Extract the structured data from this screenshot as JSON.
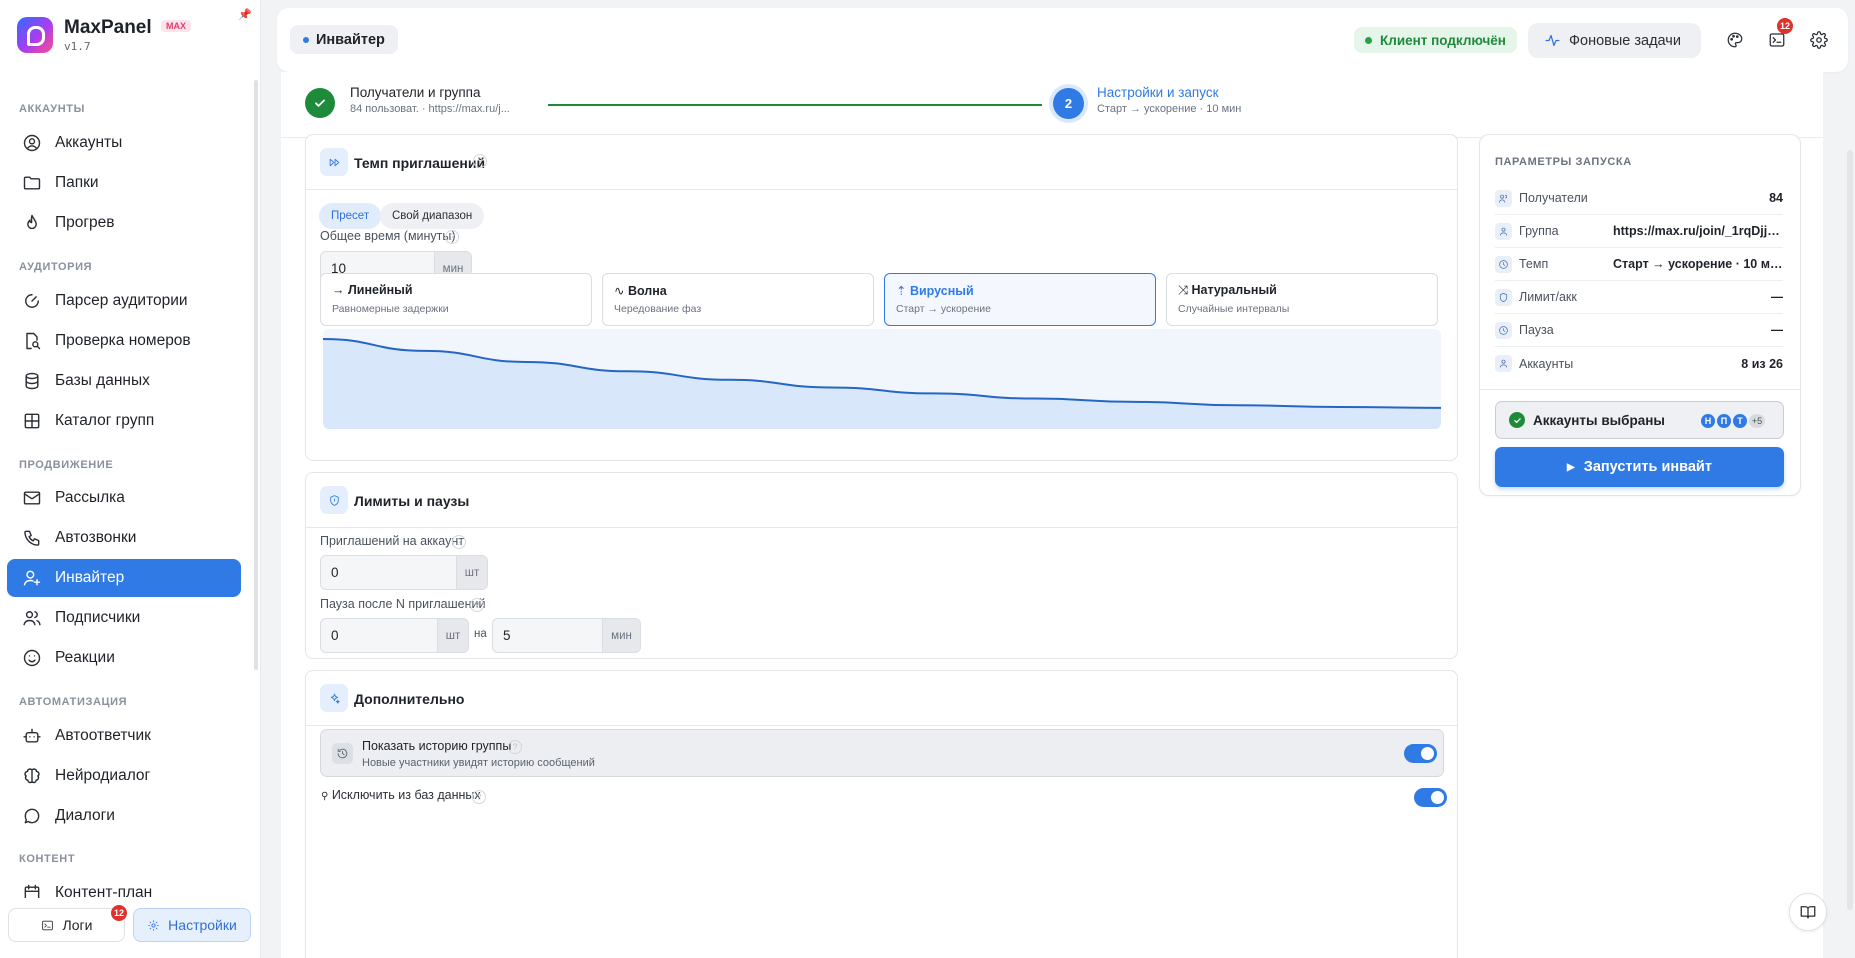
{
  "brand": {
    "name": "MaxPanel",
    "badge": "MAX",
    "version": "v1.7"
  },
  "sidebar": {
    "sections": [
      {
        "title": "АККАУНТЫ"
      },
      {
        "title": "АУДИТОРИЯ"
      },
      {
        "title": "ПРОДВИЖЕНИЕ"
      },
      {
        "title": "АВТОМАТИЗАЦИЯ"
      },
      {
        "title": "КОНТЕНТ"
      }
    ],
    "items": [
      {
        "label": "Аккаунты",
        "icon": "user-circle-icon"
      },
      {
        "label": "Папки",
        "icon": "folder-icon"
      },
      {
        "label": "Прогрев",
        "icon": "flame-icon"
      },
      {
        "label": "Парсер аудитории",
        "icon": "radar-icon"
      },
      {
        "label": "Проверка номеров",
        "icon": "file-search-icon"
      },
      {
        "label": "Базы данных",
        "icon": "database-icon"
      },
      {
        "label": "Каталог групп",
        "icon": "grid-icon"
      },
      {
        "label": "Рассылка",
        "icon": "mail-icon"
      },
      {
        "label": "Автозвонки",
        "icon": "phone-icon"
      },
      {
        "label": "Инвайтер",
        "icon": "user-plus-icon",
        "active": true
      },
      {
        "label": "Подписчики",
        "icon": "users-icon"
      },
      {
        "label": "Реакции",
        "icon": "smile-icon"
      },
      {
        "label": "Автоответчик",
        "icon": "bot-icon"
      },
      {
        "label": "Нейродиалог",
        "icon": "brain-icon"
      },
      {
        "label": "Диалоги",
        "icon": "chat-icon"
      },
      {
        "label": "Контент-план",
        "icon": "calendar-icon"
      }
    ],
    "footer": {
      "logs_label": "Логи",
      "logs_badge": "12",
      "settings_label": "Настройки"
    }
  },
  "topbar": {
    "page_title": "Инвайтер",
    "connection_status": "Клиент подключён",
    "background_tasks": "Фоновые задачи",
    "terminal_badge": "12"
  },
  "steps": [
    {
      "title": "Получатели и группа",
      "subtitle": "84 пользоват. · https://max.ru/j...",
      "state": "done"
    },
    {
      "number": "2",
      "title": "Настройки и запуск",
      "subtitle": "Старт → ускорение · 10 мин",
      "state": "active"
    }
  ],
  "tempo": {
    "title": "Темп приглашений",
    "tabs": [
      "Пресет",
      "Свой диапазон"
    ],
    "active_tab": "Пресет",
    "total_time_label": "Общее время (минуты)",
    "total_time_value": "10",
    "total_time_unit": "мин",
    "presets": [
      {
        "name": "Линейный",
        "desc": "Равномерные задержки",
        "icon": "arrow-right-icon"
      },
      {
        "name": "Волна",
        "desc": "Чередование фаз",
        "icon": "pulse-icon"
      },
      {
        "name": "Вирусный",
        "desc": "Старт → ускорение",
        "icon": "rocket-icon",
        "selected": true
      },
      {
        "name": "Натуральный",
        "desc": "Случайные интервалы",
        "icon": "shuffle-icon"
      }
    ],
    "curve": [
      1.0,
      0.86,
      0.73,
      0.62,
      0.52,
      0.43,
      0.36,
      0.3,
      0.26,
      0.22,
      0.2,
      0.19
    ]
  },
  "limits": {
    "title": "Лимиты и паузы",
    "per_account_label": "Приглашений на аккаунт",
    "per_account_value": "0",
    "per_account_unit": "шт",
    "pause_label": "Пауза после N приглашений",
    "pause_count_value": "0",
    "pause_count_unit": "шт",
    "pause_on": "на",
    "pause_duration_value": "5",
    "pause_duration_unit": "мин"
  },
  "extra": {
    "title": "Дополнительно",
    "history_title": "Показать историю группы",
    "history_desc": "Новые участники увидят историю сообщений",
    "history_enabled": true,
    "exclude_label": "Исключить из баз данных",
    "exclude_enabled": true
  },
  "summary": {
    "title": "ПАРАМЕТРЫ ЗАПУСКА",
    "rows": [
      {
        "label": "Получатели",
        "value": "84",
        "icon": "users-icon"
      },
      {
        "label": "Группа",
        "value": "https://max.ru/join/_1rqDjj4...",
        "icon": "group-icon"
      },
      {
        "label": "Темп",
        "value": "Старт → ускорение · 10 мин",
        "icon": "clock-icon"
      },
      {
        "label": "Лимит/акк",
        "value": "—",
        "icon": "shield-icon"
      },
      {
        "label": "Пауза",
        "value": "—",
        "icon": "clock-icon"
      },
      {
        "label": "Аккаунты",
        "value": "8 из 26",
        "icon": "user-icon"
      }
    ],
    "accounts_selected": "Аккаунты выбраны",
    "avatars": [
      "Н",
      "П",
      "Т"
    ],
    "avatars_more": "+5",
    "launch_button": "Запустить инвайт"
  }
}
